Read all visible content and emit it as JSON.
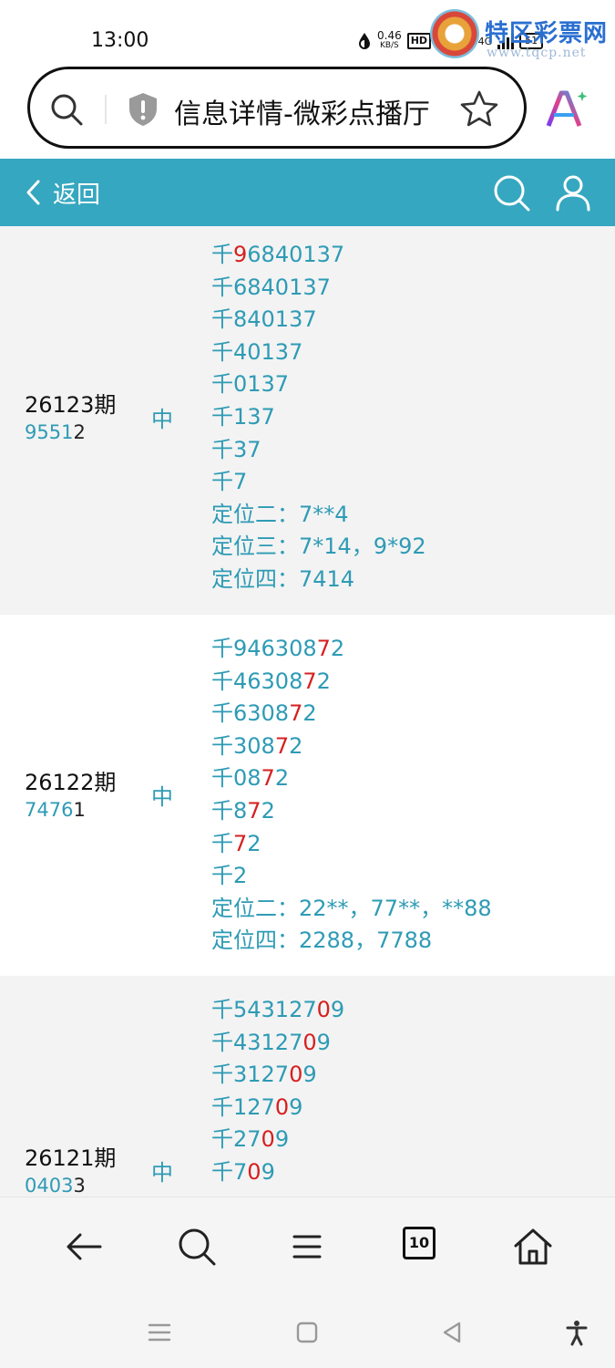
{
  "status_bar": {
    "time": "13:00",
    "net_speed": "0.46",
    "net_speed_unit": "KB/S",
    "hd": "HD",
    "net_5g": "5G",
    "net_4g": "4G",
    "battery": "51"
  },
  "watermark": {
    "title": "特区彩票网",
    "url": "www.tqcp.net"
  },
  "url_bar": {
    "title": "信息详情-微彩点播厅"
  },
  "header": {
    "back_label": "返回"
  },
  "rows": [
    {
      "issue": "26123期",
      "draw_prefix": "9551",
      "draw_last": "2",
      "status": "中",
      "lines": [
        [
          {
            "t": "千",
            "h": false
          },
          {
            "t": "9",
            "h": true
          },
          {
            "t": "6840137",
            "h": false
          }
        ],
        [
          {
            "t": "千6840137",
            "h": false
          }
        ],
        [
          {
            "t": "千840137",
            "h": false
          }
        ],
        [
          {
            "t": "千40137",
            "h": false
          }
        ],
        [
          {
            "t": "千0137",
            "h": false
          }
        ],
        [
          {
            "t": "千137",
            "h": false
          }
        ],
        [
          {
            "t": "千37",
            "h": false
          }
        ],
        [
          {
            "t": "千7",
            "h": false
          }
        ],
        [
          {
            "t": "定位二：7**4",
            "h": false
          }
        ],
        [
          {
            "t": "定位三：7*14，9*92",
            "h": false
          }
        ],
        [
          {
            "t": "定位四：7414",
            "h": false
          }
        ]
      ]
    },
    {
      "issue": "26122期",
      "draw_prefix": "7476",
      "draw_last": "1",
      "status": "中",
      "lines": [
        [
          {
            "t": "千946308",
            "h": false
          },
          {
            "t": "7",
            "h": true
          },
          {
            "t": "2",
            "h": false
          }
        ],
        [
          {
            "t": "千46308",
            "h": false
          },
          {
            "t": "7",
            "h": true
          },
          {
            "t": "2",
            "h": false
          }
        ],
        [
          {
            "t": "千6308",
            "h": false
          },
          {
            "t": "7",
            "h": true
          },
          {
            "t": "2",
            "h": false
          }
        ],
        [
          {
            "t": "千308",
            "h": false
          },
          {
            "t": "7",
            "h": true
          },
          {
            "t": "2",
            "h": false
          }
        ],
        [
          {
            "t": "千08",
            "h": false
          },
          {
            "t": "7",
            "h": true
          },
          {
            "t": "2",
            "h": false
          }
        ],
        [
          {
            "t": "千8",
            "h": false
          },
          {
            "t": "7",
            "h": true
          },
          {
            "t": "2",
            "h": false
          }
        ],
        [
          {
            "t": "千",
            "h": false
          },
          {
            "t": "7",
            "h": true
          },
          {
            "t": "2",
            "h": false
          }
        ],
        [
          {
            "t": "千2",
            "h": false
          }
        ],
        [
          {
            "t": "定位二：22**，77**，**88",
            "h": false
          }
        ],
        [
          {
            "t": "定位四：2288，7788",
            "h": false
          }
        ]
      ]
    },
    {
      "issue": "26121期",
      "draw_prefix": "0403",
      "draw_last": "3",
      "status": "中",
      "lines": [
        [
          {
            "t": "千543127",
            "h": false
          },
          {
            "t": "0",
            "h": true
          },
          {
            "t": "9",
            "h": false
          }
        ],
        [
          {
            "t": "千43127",
            "h": false
          },
          {
            "t": "0",
            "h": true
          },
          {
            "t": "9",
            "h": false
          }
        ],
        [
          {
            "t": "千3127",
            "h": false
          },
          {
            "t": "0",
            "h": true
          },
          {
            "t": "9",
            "h": false
          }
        ],
        [
          {
            "t": "千127",
            "h": false
          },
          {
            "t": "0",
            "h": true
          },
          {
            "t": "9",
            "h": false
          }
        ],
        [
          {
            "t": "千27",
            "h": false
          },
          {
            "t": "0",
            "h": true
          },
          {
            "t": "9",
            "h": false
          }
        ],
        [
          {
            "t": "千7",
            "h": false
          },
          {
            "t": "0",
            "h": true
          },
          {
            "t": "9",
            "h": false
          }
        ]
      ]
    }
  ],
  "bottom_bar": {
    "tab_count": "10"
  }
}
